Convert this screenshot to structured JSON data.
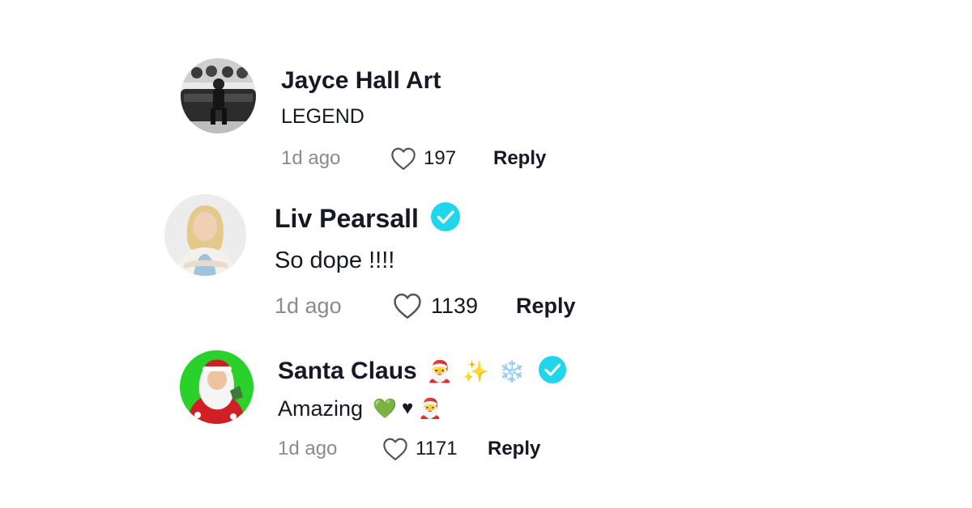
{
  "colors": {
    "verified": "#20D5EC",
    "text_primary": "#161823",
    "text_secondary": "#8a8b91"
  },
  "comments": [
    {
      "author": "Jayce Hall Art",
      "verified": false,
      "text": "LEGEND",
      "time": "1d ago",
      "likes": "197",
      "reply_label": "Reply",
      "avatar_icon": "person-on-sofa-photo"
    },
    {
      "author": "Liv Pearsall",
      "verified": true,
      "text": "So dope !!!!",
      "time": "1d ago",
      "likes": "1139",
      "reply_label": "Reply",
      "avatar_icon": "blonde-woman-photo"
    },
    {
      "author": "Santa Claus",
      "name_emojis": [
        "🎅",
        "✨",
        "❄️"
      ],
      "verified": true,
      "text": "Amazing",
      "text_emojis": [
        "💚",
        "♥",
        "🎅"
      ],
      "time": "1d ago",
      "likes": "1171",
      "reply_label": "Reply",
      "avatar_icon": "santa-claus-photo"
    }
  ]
}
